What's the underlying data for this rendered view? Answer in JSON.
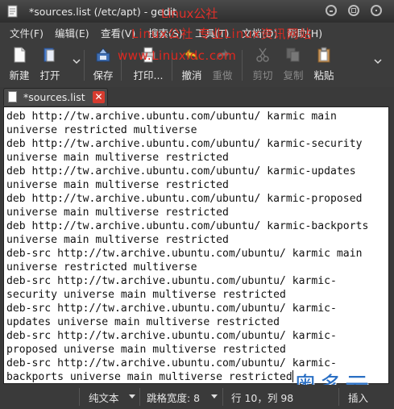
{
  "window": {
    "title": "*sources.list (/etc/apt) - gedit",
    "watermark_top": "Linux公社"
  },
  "menu": [
    {
      "label": "文件(F)"
    },
    {
      "label": "编辑(E)"
    },
    {
      "label": "查看(V)"
    },
    {
      "label": "搜索(S)"
    },
    {
      "label": "工具(T)"
    },
    {
      "label": "文档(D)"
    },
    {
      "label": "帮助(H)"
    }
  ],
  "watermark_menu": "Linux公社 专业Linux资讯网站",
  "watermark_toolbar": "www.Linuxidc.com",
  "toolbar": {
    "new_label": "新建",
    "open_label": "打开",
    "save_label": "保存",
    "print_label": "打印...",
    "undo_label": "撤消",
    "redo_label": "重做",
    "cut_label": "剪切",
    "copy_label": "复制",
    "paste_label": "粘贴"
  },
  "tab": {
    "label": "*sources.list"
  },
  "editor": {
    "lines": [
      "deb http://tw.archive.ubuntu.com/ubuntu/ karmic main",
      "universe restricted multiverse",
      "deb http://tw.archive.ubuntu.com/ubuntu/ karmic-security",
      "universe main multiverse restricted",
      "deb http://tw.archive.ubuntu.com/ubuntu/ karmic-updates",
      "universe main multiverse restricted",
      "deb http://tw.archive.ubuntu.com/ubuntu/ karmic-proposed",
      "universe main multiverse restricted",
      "deb http://tw.archive.ubuntu.com/ubuntu/ karmic-backports",
      "universe main multiverse restricted",
      "deb-src http://tw.archive.ubuntu.com/ubuntu/ karmic main",
      "universe restricted multiverse",
      "deb-src http://tw.archive.ubuntu.com/ubuntu/ karmic-",
      "security universe main multiverse restricted",
      "deb-src http://tw.archive.ubuntu.com/ubuntu/ karmic-",
      "updates universe main multiverse restricted",
      "deb-src http://tw.archive.ubuntu.com/ubuntu/ karmic-",
      "proposed universe main multiverse restricted",
      "deb-src http://tw.archive.ubuntu.com/ubuntu/ karmic-",
      "backports universe main multiverse restricted"
    ]
  },
  "watermark_corner": "奥多云",
  "status": {
    "language": "纯文本",
    "tab_width": "跳格宽度: 8",
    "position": "行 10，列 98",
    "mode": "插入"
  },
  "colors": {
    "editor_bg": "#ffffff",
    "chrome_bg": "#3c3c3c",
    "watermark_red": "#e02820",
    "watermark_blue": "#2a6fc4",
    "tab_close": "#d63b2f"
  }
}
